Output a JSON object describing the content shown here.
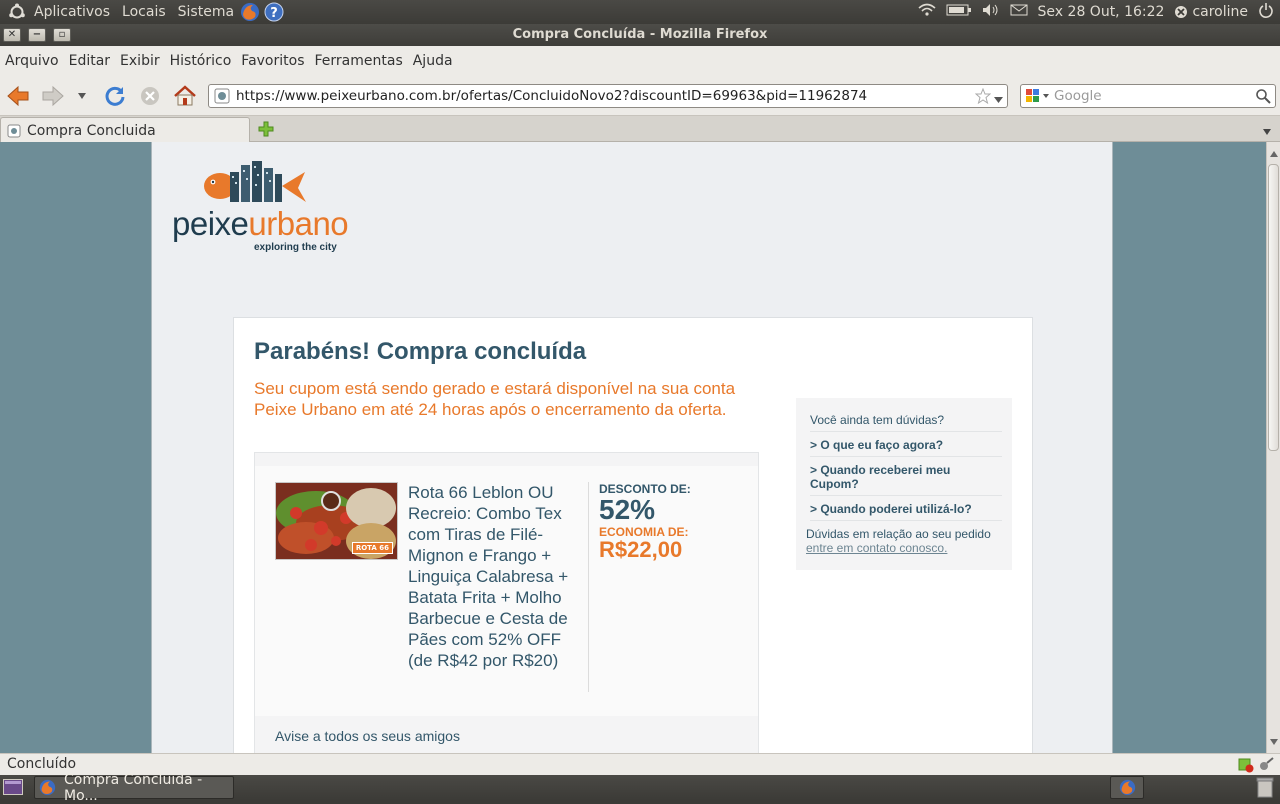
{
  "panel": {
    "applications": "Aplicativos",
    "places": "Locais",
    "system": "Sistema",
    "clock": "Sex 28 Out, 16:22",
    "user": "caroline"
  },
  "window": {
    "title": "Compra Concluída - Mozilla Firefox"
  },
  "menu": [
    "Arquivo",
    "Editar",
    "Exibir",
    "Histórico",
    "Favoritos",
    "Ferramentas",
    "Ajuda"
  ],
  "nav": {
    "url": "https://www.peixeurbano.com.br/ofertas/ConcluidoNovo2?discountID=69963&pid=11962874",
    "search_placeholder": "Google"
  },
  "tabs": [
    {
      "label": "Compra Concluida"
    }
  ],
  "page": {
    "logo_text_a": "peixe",
    "logo_text_b": "urbano",
    "logo_tagline": "exploring the city",
    "heading": "Parabéns! Compra concluída",
    "subheading": "Seu cupom está sendo gerado e estará disponível na sua conta Peixe Urbano em até 24 horas após o encerramento da oferta.",
    "deal": {
      "image_badge": "ROTA 66",
      "title": "Rota 66 Leblon OU Recreio: Combo Tex com Tiras de Filé-Mignon e Frango + Linguiça Calabresa + Batata Frita + Molho Barbecue e Cesta de Pães com 52% OFF (de R$42 por R$20)",
      "discount_label": "DESCONTO DE:",
      "discount_value": "52%",
      "savings_label": "ECONOMIA DE:",
      "savings_value": "R$22,00",
      "share_label": "Avise a todos os seus amigos"
    },
    "faq": {
      "header": "Você ainda tem dúvidas?",
      "q1": "> O que eu faço agora?",
      "q2": "> Quando receberei meu Cupom?",
      "q3": "> Quando poderei utilizá-lo?",
      "footer": "Dúvidas em relação ao seu pedido",
      "footer_link": "entre em contato conosco."
    }
  },
  "status": {
    "text": "Concluído"
  },
  "taskbar": {
    "item": "Compra Concluida - Mo..."
  },
  "colors": {
    "brand_blue": "#33576a",
    "brand_orange": "#e8792b",
    "page_bg": "#6e8d97"
  }
}
